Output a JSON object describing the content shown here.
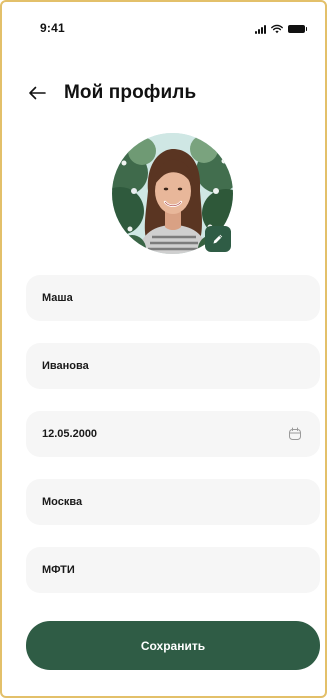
{
  "status_bar": {
    "time": "9:41",
    "icons": [
      "signal-icon",
      "wifi-icon",
      "battery-icon"
    ]
  },
  "header": {
    "back_icon": "arrow-left-icon",
    "title": "Мой профиль"
  },
  "avatar": {
    "edit_icon": "pencil-icon"
  },
  "form": {
    "first_name": {
      "value": "Маша"
    },
    "last_name": {
      "value": "Иванова"
    },
    "birth_date": {
      "value": "12.05.2000",
      "icon": "calendar-icon"
    },
    "city": {
      "value": "Москва"
    },
    "university": {
      "value": "МФТИ"
    }
  },
  "actions": {
    "save_label": "Сохранить"
  },
  "colors": {
    "accent": "#2f5c45",
    "field_bg": "#f6f6f6",
    "frame_border": "#e3c06a"
  }
}
